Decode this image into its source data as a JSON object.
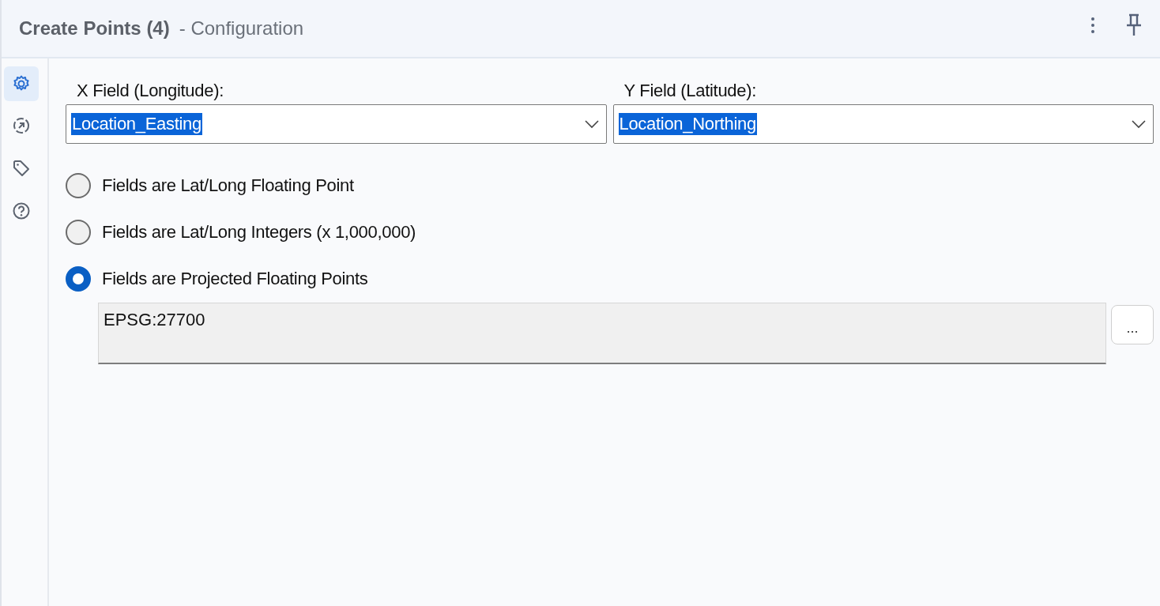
{
  "window": {
    "title": "Create Points (4)",
    "subtitle": "- Configuration"
  },
  "sidebar": {
    "items": [
      {
        "kind": "settings",
        "selected": true
      },
      {
        "kind": "connection",
        "selected": false
      },
      {
        "kind": "tag",
        "selected": false
      },
      {
        "kind": "help",
        "selected": false
      }
    ]
  },
  "fields": [
    {
      "label": "X Field (Longitude):",
      "value": "Location_Easting"
    },
    {
      "label": "Y Field (Latitude):",
      "value": "Location_Northing"
    }
  ],
  "options": [
    {
      "label": "Fields are Lat/Long Floating Point",
      "selected": false
    },
    {
      "label": "Fields are Lat/Long Integers (x 1,000,000)",
      "selected": false
    },
    {
      "label": "Fields are Projected Floating Points",
      "selected": true
    }
  ],
  "projection": {
    "value": "EPSG:27700",
    "button": "..."
  }
}
